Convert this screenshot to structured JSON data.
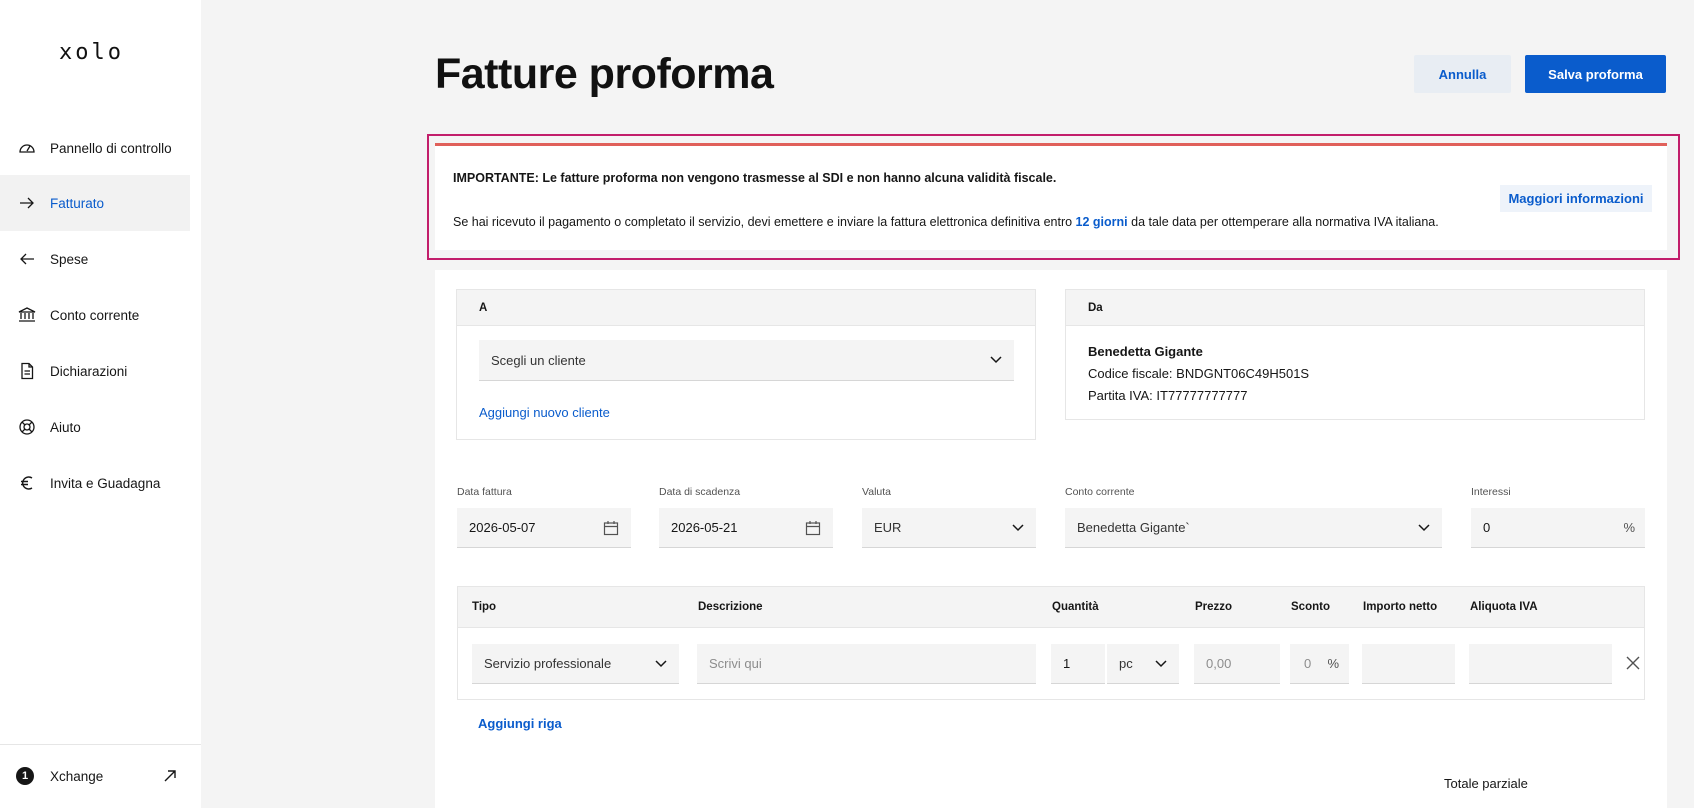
{
  "app": {
    "logo": "xolo"
  },
  "sidebar": {
    "items": [
      {
        "label": "Pannello di controllo",
        "icon": "gauge-icon"
      },
      {
        "label": "Fatturato",
        "icon": "arrow-right-icon",
        "active": true
      },
      {
        "label": "Spese",
        "icon": "arrow-left-icon"
      },
      {
        "label": "Conto corrente",
        "icon": "bank-icon"
      },
      {
        "label": "Dichiarazioni",
        "icon": "document-icon"
      },
      {
        "label": "Aiuto",
        "icon": "lifebuoy-icon"
      },
      {
        "label": "Invita e Guadagna",
        "icon": "euro-icon"
      }
    ],
    "bottom": {
      "badge": "1",
      "label": "Xchange",
      "icon": "external-link-icon"
    }
  },
  "header": {
    "title": "Fatture proforma",
    "cancel_label": "Annulla",
    "save_label": "Salva proforma"
  },
  "alert": {
    "strong": "IMPORTANTE: Le fatture proforma non vengono trasmesse al SDI e non hanno alcuna validità fiscale.",
    "text_before": "Se hai ricevuto il pagamento o completato il servizio, devi emettere e inviare la fattura elettronica definitiva entro ",
    "link": "12 giorni",
    "text_after": " da tale data per ottemperare alla normativa IVA italiana.",
    "button": "Maggiori informazioni",
    "accent_color": "#e0605a"
  },
  "to_panel": {
    "header": "A",
    "client_select": "Scegli un cliente",
    "add_client": "Aggiungi nuovo cliente"
  },
  "from_panel": {
    "header": "Da",
    "name": "Benedetta Gigante",
    "tax_code": "Codice fiscale: BNDGNT06C49H501S",
    "vat": "Partita IVA: IT77777777777"
  },
  "fields": {
    "invoice_date_label": "Data fattura",
    "invoice_date": "2026-05-07",
    "due_date_label": "Data di scadenza",
    "due_date": "2026-05-21",
    "currency_label": "Valuta",
    "currency": "EUR",
    "account_label": "Conto corrente",
    "account": "Benedetta Gigante`",
    "interest_label": "Interessi",
    "interest": "0",
    "interest_unit": "%"
  },
  "table": {
    "headers": [
      "Tipo",
      "Descrizione",
      "Quantità",
      "Prezzo",
      "Sconto",
      "Importo netto",
      "Aliquota IVA"
    ],
    "row": {
      "type": "Servizio professionale",
      "description_placeholder": "Scrivi qui",
      "quantity": "1",
      "unit": "pc",
      "price_placeholder": "0,00",
      "discount_placeholder": "0",
      "discount_unit": "%"
    },
    "add_row": "Aggiungi riga"
  },
  "totals": {
    "subtotal_label": "Totale parziale"
  },
  "colors": {
    "primary": "#0a5ccc",
    "alert_outline": "#c21e6b"
  }
}
